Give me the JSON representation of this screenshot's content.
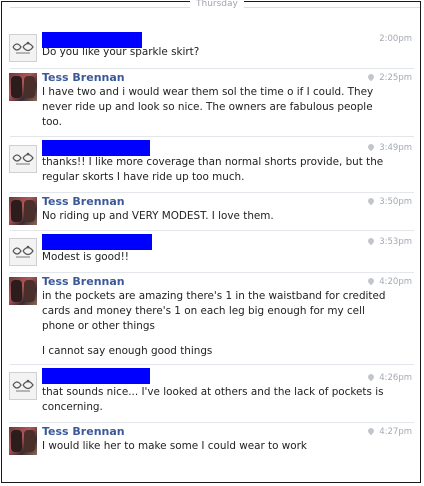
{
  "conversation": {
    "day_label": "Thursday",
    "messages": [
      {
        "sender": "",
        "redacted": true,
        "time": "2:00pm",
        "show_pin": false,
        "lines": [
          "Do you like your sparkle skirt?"
        ]
      },
      {
        "sender": "Tess Brennan",
        "redacted": false,
        "time": "2:25pm",
        "show_pin": true,
        "lines": [
          "I have two and i would wear them sol the time o if I could.  They never ride up and look so nice. The owners are fabulous people too."
        ]
      },
      {
        "sender": "",
        "redacted": true,
        "time": "3:49pm",
        "show_pin": true,
        "lines": [
          "thanks!! I like more coverage than normal shorts provide, but the regular skorts I have ride up too much."
        ]
      },
      {
        "sender": "Tess Brennan",
        "redacted": false,
        "time": "3:50pm",
        "show_pin": true,
        "lines": [
          "No riding up and VERY MODEST. I love them."
        ]
      },
      {
        "sender": "",
        "redacted": true,
        "time": "3:53pm",
        "show_pin": true,
        "lines": [
          "Modest is good!!"
        ]
      },
      {
        "sender": "Tess Brennan",
        "redacted": false,
        "time": "4:20pm",
        "show_pin": true,
        "lines": [
          "in the pockets are amazing there's 1 in the waistband for credited cards and money there's 1 on each leg big enough for my cell phone or other things",
          "I cannot say enough good things"
        ]
      },
      {
        "sender": "",
        "redacted": true,
        "time": "4:26pm",
        "show_pin": true,
        "lines": [
          "that sounds nice... I've looked at others and the lack of pockets is concerning."
        ]
      },
      {
        "sender": "Tess Brennan",
        "redacted": false,
        "time": "4:27pm",
        "show_pin": true,
        "lines": [
          "I would like her to make some I could wear to work"
        ]
      }
    ]
  }
}
